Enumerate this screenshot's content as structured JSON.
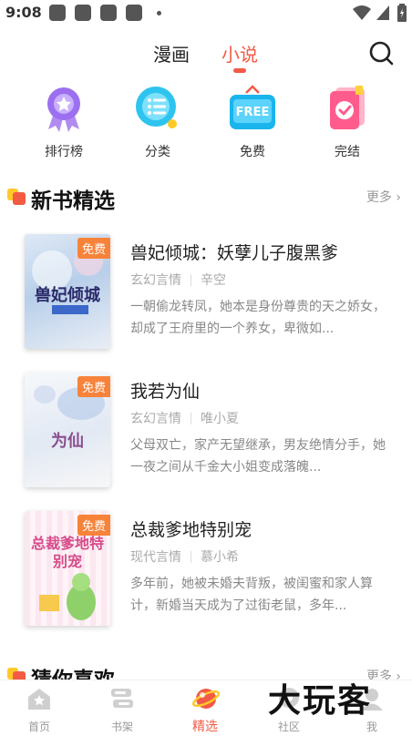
{
  "status_bar": {
    "time": "9:08"
  },
  "top_tabs": [
    {
      "label": "漫画",
      "active": false
    },
    {
      "label": "小说",
      "active": true
    }
  ],
  "categories": [
    {
      "label": "排行榜",
      "icon": "ranking-icon"
    },
    {
      "label": "分类",
      "icon": "category-icon"
    },
    {
      "label": "免费",
      "icon": "free-icon",
      "icon_text": "FREE"
    },
    {
      "label": "完结",
      "icon": "completed-icon"
    }
  ],
  "sections": {
    "new_books": {
      "title": "新书精选",
      "more": "更多 ›"
    },
    "guess_like": {
      "title": "猜你喜欢",
      "more": "更多 ›"
    }
  },
  "books": [
    {
      "title": "兽妃倾城：妖孽儿子腹黑爹",
      "genre": "玄幻言情",
      "author": "辛空",
      "desc": "一朝偷龙转凤，她本是身份尊贵的天之娇女，却成了王府里的一个养女，卑微如...",
      "badge": "免费",
      "cover_text": "兽妃倾城"
    },
    {
      "title": "我若为仙",
      "genre": "玄幻言情",
      "author": "唯小夏",
      "desc": "父母双亡，家产无望继承，男友绝情分手，她一夜之间从千金大小姐变成落魄...",
      "badge": "免费",
      "cover_text": "为仙"
    },
    {
      "title": "总裁爹地特别宠",
      "genre": "现代言情",
      "author": "慕小希",
      "desc": "多年前，她被未婚夫背叛，被闺蜜和家人算计，新婚当天成为了过街老鼠，多年...",
      "badge": "免费",
      "cover_text": "总裁爹地特别宠"
    }
  ],
  "bottom_nav": [
    {
      "label": "首页",
      "active": false
    },
    {
      "label": "书架",
      "active": false
    },
    {
      "label": "精选",
      "active": true
    },
    {
      "label": "社区",
      "active": false
    },
    {
      "label": "我",
      "active": false
    }
  ],
  "watermark": "大玩客",
  "colors": {
    "accent": "#f25a45",
    "badge": "#f7833a",
    "section_yellow": "#ffc928"
  }
}
